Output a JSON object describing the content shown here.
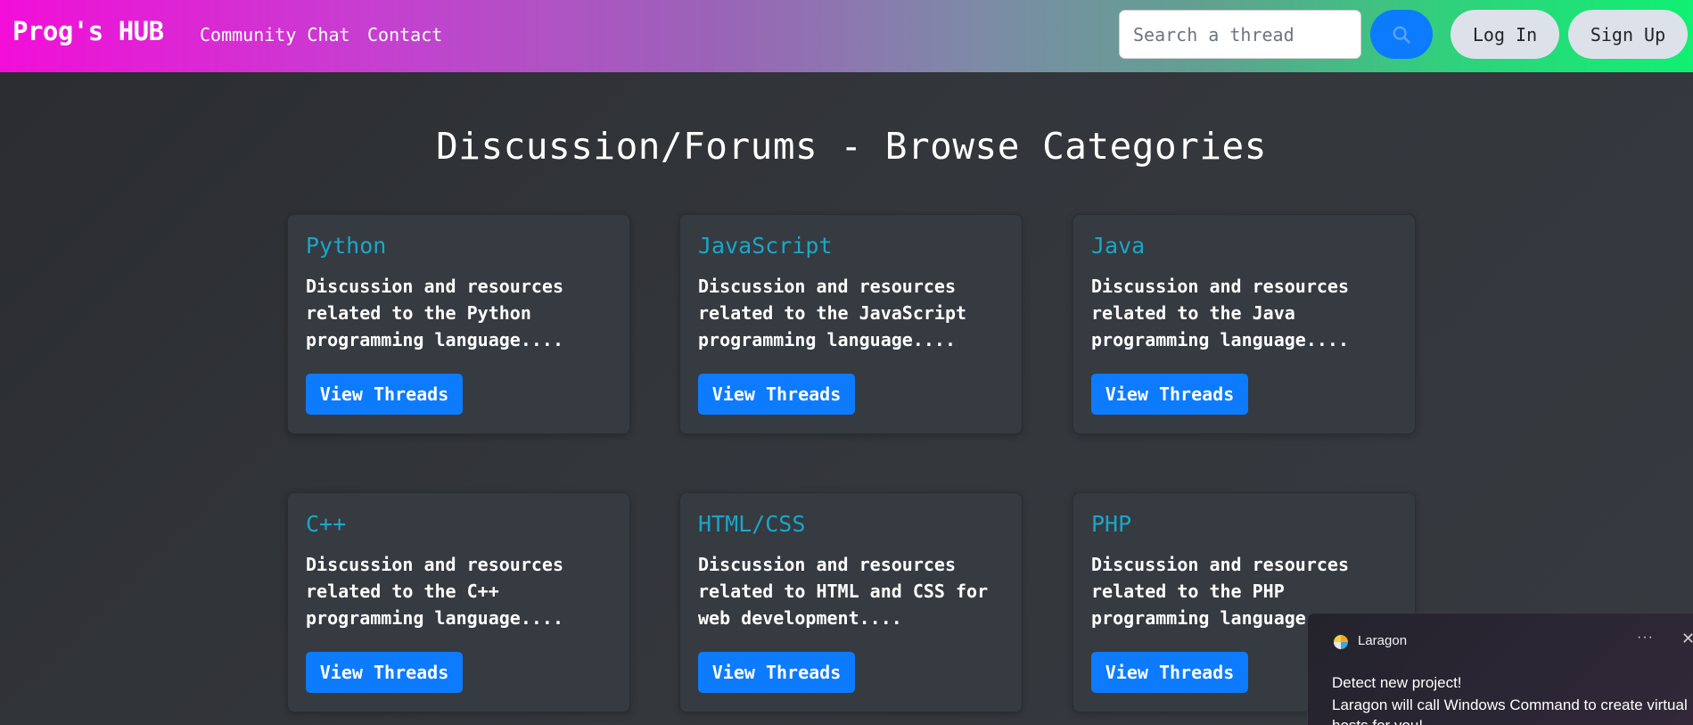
{
  "navbar": {
    "brand": "Prog's HUB",
    "links": [
      "Community Chat",
      "Contact"
    ],
    "search_placeholder": "Search a thread",
    "login_label": "Log In",
    "signup_label": "Sign Up",
    "gradient": [
      "#f20ed8",
      "#10f072"
    ]
  },
  "main": {
    "title": "Discussion/Forums - Browse Categories",
    "categories": [
      {
        "name": "Python",
        "description": "Discussion and resources related to the Python programming language....",
        "button": "View Threads"
      },
      {
        "name": "JavaScript",
        "description": "Discussion and resources related to the JavaScript programming language....",
        "button": "View Threads"
      },
      {
        "name": "Java",
        "description": "Discussion and resources related to the Java programming language....",
        "button": "View Threads"
      },
      {
        "name": "C++",
        "description": "Discussion and resources related to the C++ programming language....",
        "button": "View Threads"
      },
      {
        "name": "HTML/CSS",
        "description": "Discussion and resources related to HTML and CSS for web development....",
        "button": "View Threads"
      },
      {
        "name": "PHP",
        "description": "Discussion and resources related to the PHP programming language",
        "button": "View Threads"
      }
    ],
    "accent_color": "#19a7c8",
    "button_color": "#0d7bfd"
  },
  "toast": {
    "app_name": "Laragon",
    "more_icon": "more-icon",
    "close_icon": "close-icon",
    "title": "Detect new project!",
    "body": "Laragon will call Windows Command to create virtual hosts for you!"
  }
}
